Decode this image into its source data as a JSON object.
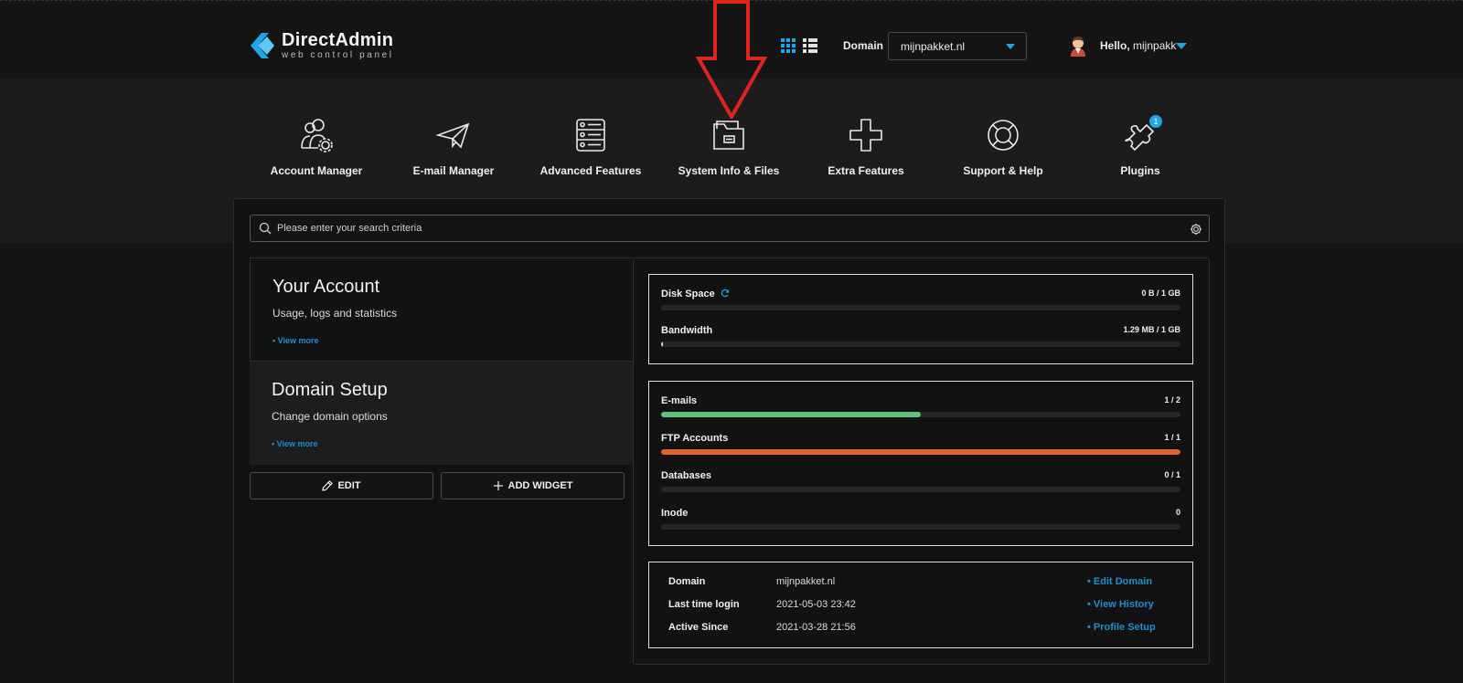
{
  "header": {
    "logo_name": "DirectAdmin",
    "logo_sub": "web control panel",
    "domain_label": "Domain",
    "domain_value": "mijnpakket.nl",
    "hello_prefix": "Hello,",
    "hello_user": "mijnpakk",
    "accent_color": "#1ea6e8"
  },
  "menu": [
    {
      "label": "Account Manager",
      "icon": "account-manager-icon"
    },
    {
      "label": "E-mail Manager",
      "icon": "paper-plane-icon"
    },
    {
      "label": "Advanced Features",
      "icon": "server-stack-icon"
    },
    {
      "label": "System Info & Files",
      "icon": "folder-icon"
    },
    {
      "label": "Extra Features",
      "icon": "plus-icon"
    },
    {
      "label": "Support & Help",
      "icon": "lifebuoy-icon"
    },
    {
      "label": "Plugins",
      "icon": "puzzle-icon",
      "badge": "1"
    }
  ],
  "search": {
    "placeholder": "Please enter your search criteria"
  },
  "cards": [
    {
      "title": "Your Account",
      "subtitle": "Usage, logs and statistics",
      "link": "• View more"
    },
    {
      "title": "Domain Setup",
      "subtitle": "Change domain options",
      "link": "• View more"
    }
  ],
  "buttons": {
    "edit": "EDIT",
    "add_widget": "ADD WIDGET"
  },
  "usage": [
    {
      "name": "Disk Space",
      "value": "0 B / 1 GB",
      "fill": 0,
      "color": "#1ea6e8"
    },
    {
      "name": "Bandwidth",
      "value": "1.29 MB / 1 GB",
      "fill": 0.0013,
      "color": "#dcdcdc"
    }
  ],
  "limits": [
    {
      "name": "E-mails",
      "value": "1 / 2",
      "fill": 0.5,
      "color": "#5ec27a"
    },
    {
      "name": "FTP Accounts",
      "value": "1 / 1",
      "fill": 1.0,
      "color": "#e0652a"
    },
    {
      "name": "Databases",
      "value": "0 / 1",
      "fill": 0,
      "color": "#5ec27a"
    },
    {
      "name": "Inode",
      "value": "0",
      "fill": 0,
      "color": "#5ec27a"
    }
  ],
  "info": [
    {
      "key": "Domain",
      "value": "mijnpakket.nl",
      "link": "• Edit Domain"
    },
    {
      "key": "Last time login",
      "value": "2021-05-03 23:42",
      "link": "• View History"
    },
    {
      "key": "Active Since",
      "value": "2021-03-28 21:56",
      "link": "• Profile Setup"
    }
  ]
}
